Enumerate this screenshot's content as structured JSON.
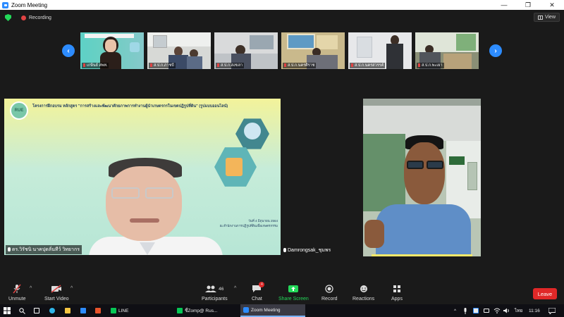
{
  "window": {
    "title": "Zoom Meeting",
    "minimize": "—",
    "maximize": "❐",
    "close": "✕"
  },
  "info_bar": {
    "recording_label": "Recording",
    "view_label": "View"
  },
  "thumbnails": [
    {
      "name": "เกษีนย์ สพท."
    },
    {
      "name": "ส.ป.ก.ภาชบี"
    },
    {
      "name": "ส.ป.ก.สงขลา"
    },
    {
      "name": "ส.ป.ก.นครศิราช"
    },
    {
      "name": "ส.ป.ก.นครสวรรค์"
    },
    {
      "name": "ส.ป.ก.พะเยา"
    }
  ],
  "main_tiles": {
    "left_name": "ดร.วิรัชนิ นาคปุดลั่นทีว์ วิทยากร",
    "slide_title": "โครงการฝึกอบรม หลักสูตร \"การสร้างและพัฒนาศักยภาพการทำงานผู้นำเกษตรกรในเขตปฏิรูปที่ดิน\" (รูปแบบออนไลน์)",
    "slide_badge": "RUE",
    "slide_date": "วันที่ 4 มิถุนายน 2564",
    "slide_org": "ณ สำนักงานการปฏิรูปที่ดินเพื่อเกษตรกรรม",
    "right_name": "Damrongsak_ชุมพร"
  },
  "toolbar": {
    "unmute": "Unmute",
    "start_video": "Start Video",
    "participants": "Participants",
    "participants_count": "46",
    "chat": "Chat",
    "chat_badge": "4",
    "share_screen": "Share Screen",
    "record": "Record",
    "reactions": "Reactions",
    "apps": "Apps",
    "leave": "Leave"
  },
  "taskbar": {
    "line_app": "LINE",
    "rus_app": "ชื่Zоmp@ Rus...",
    "zoom_app": "Zoom Meeting",
    "lang": "ไทย",
    "time": "11:16"
  },
  "colors": {
    "accent": "#2d8cff",
    "leave": "#e02828",
    "share": "#23d959",
    "recording": "#e04343"
  }
}
